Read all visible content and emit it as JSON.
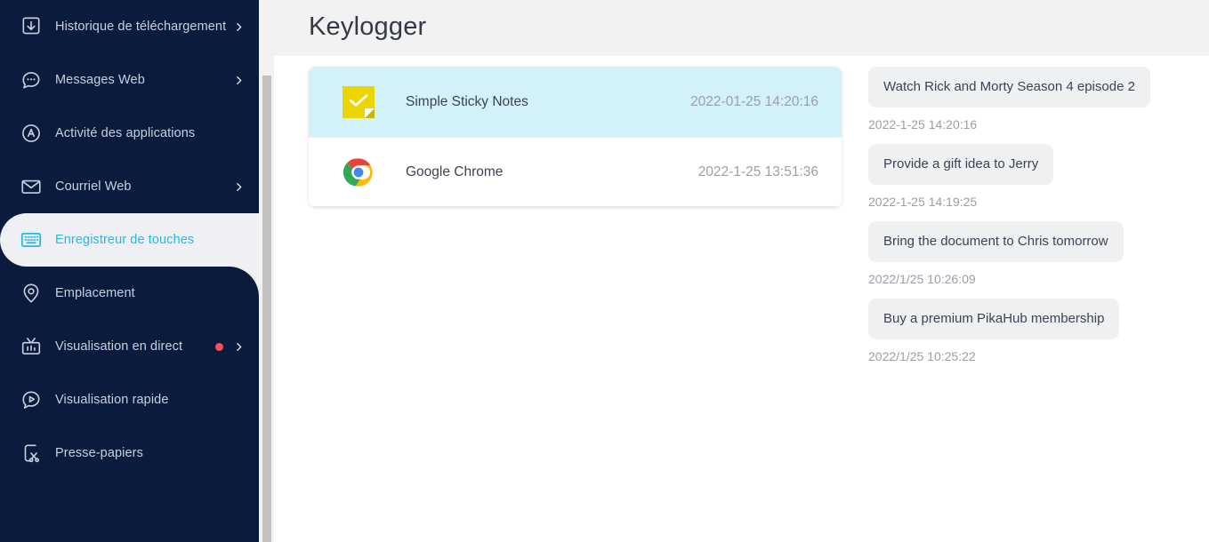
{
  "sidebar": {
    "items": [
      {
        "label": "Historique de téléchargement",
        "icon": "download-box-icon",
        "chevron": true,
        "dot": false,
        "active": false
      },
      {
        "label": "Messages Web",
        "icon": "chat-bubble-icon",
        "chevron": true,
        "dot": false,
        "active": false
      },
      {
        "label": "Activité des applications",
        "icon": "app-activity-icon",
        "chevron": false,
        "dot": false,
        "active": false
      },
      {
        "label": "Courriel Web",
        "icon": "envelope-icon",
        "chevron": true,
        "dot": false,
        "active": false
      },
      {
        "label": "Enregistreur de touches",
        "icon": "keyboard-icon",
        "chevron": false,
        "dot": false,
        "active": true
      },
      {
        "label": "Emplacement",
        "icon": "location-pin-icon",
        "chevron": false,
        "dot": false,
        "active": false
      },
      {
        "label": "Visualisation en direct",
        "icon": "live-tv-icon",
        "chevron": true,
        "dot": true,
        "active": false
      },
      {
        "label": "Visualisation rapide",
        "icon": "quick-play-icon",
        "chevron": false,
        "dot": false,
        "active": false
      },
      {
        "label": "Presse-papiers",
        "icon": "clipboard-scissors-icon",
        "chevron": false,
        "dot": false,
        "active": false
      }
    ],
    "colors": {
      "background": "#0b1b3d",
      "active_background": "#eef0f3",
      "active_text": "#23b8e8",
      "label_text": "#c9d0dd",
      "badge_dot": "#f4515b"
    }
  },
  "header": {
    "title": "Keylogger",
    "background": "#f2f2f2"
  },
  "apps": {
    "rows": [
      {
        "name": "Simple Sticky Notes",
        "time": "2022-01-25 14:20:16",
        "icon": "sticky-notes-icon",
        "selected": true
      },
      {
        "name": "Google Chrome",
        "time": "2022-1-25 13:51:36",
        "icon": "chrome-icon",
        "selected": false
      }
    ],
    "selected_background": "#d3f1f8"
  },
  "messages": {
    "entries": [
      {
        "text": "Watch Rick and Morty Season 4 episode 2",
        "time": "2022-1-25 14:20:16"
      },
      {
        "text": "Provide a gift idea to Jerry",
        "time": "2022-1-25 14:19:25"
      },
      {
        "text": "Bring the document to Chris tomorrow",
        "time": "2022/1/25 10:26:09"
      },
      {
        "text": "Buy a premium PikaHub membership",
        "time": "2022/1/25 10:25:22"
      }
    ],
    "bubble_background": "#eff0f1",
    "bubble_text_color": "#3c4356",
    "timestamp_color": "#9aa0a8"
  }
}
